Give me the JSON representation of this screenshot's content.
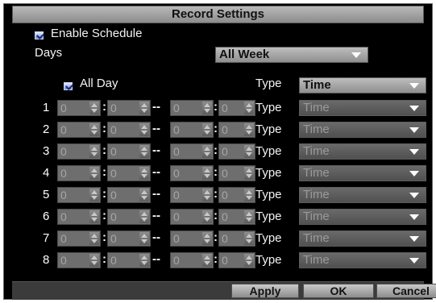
{
  "title": "Record Settings",
  "enable_schedule": {
    "label": "Enable Schedule",
    "checked": true
  },
  "days": {
    "label": "Days",
    "value": "All Week"
  },
  "all_day": {
    "label": "All Day",
    "checked": true,
    "type_label": "Type",
    "type_value": "Time"
  },
  "periods": [
    {
      "num": "1",
      "start_h": "0",
      "start_m": "0",
      "end_h": "0",
      "end_m": "0",
      "type_label": "Type",
      "type_value": "Time"
    },
    {
      "num": "2",
      "start_h": "0",
      "start_m": "0",
      "end_h": "0",
      "end_m": "0",
      "type_label": "Type",
      "type_value": "Time"
    },
    {
      "num": "3",
      "start_h": "0",
      "start_m": "0",
      "end_h": "0",
      "end_m": "0",
      "type_label": "Type",
      "type_value": "Time"
    },
    {
      "num": "4",
      "start_h": "0",
      "start_m": "0",
      "end_h": "0",
      "end_m": "0",
      "type_label": "Type",
      "type_value": "Time"
    },
    {
      "num": "5",
      "start_h": "0",
      "start_m": "0",
      "end_h": "0",
      "end_m": "0",
      "type_label": "Type",
      "type_value": "Time"
    },
    {
      "num": "6",
      "start_h": "0",
      "start_m": "0",
      "end_h": "0",
      "end_m": "0",
      "type_label": "Type",
      "type_value": "Time"
    },
    {
      "num": "7",
      "start_h": "0",
      "start_m": "0",
      "end_h": "0",
      "end_m": "0",
      "type_label": "Type",
      "type_value": "Time"
    },
    {
      "num": "8",
      "start_h": "0",
      "start_m": "0",
      "end_h": "0",
      "end_m": "0",
      "type_label": "Type",
      "type_value": "Time"
    }
  ],
  "separators": {
    "colon": ":",
    "dash": "--"
  },
  "buttons": {
    "apply": "Apply",
    "ok": "OK",
    "cancel": "Cancel"
  }
}
